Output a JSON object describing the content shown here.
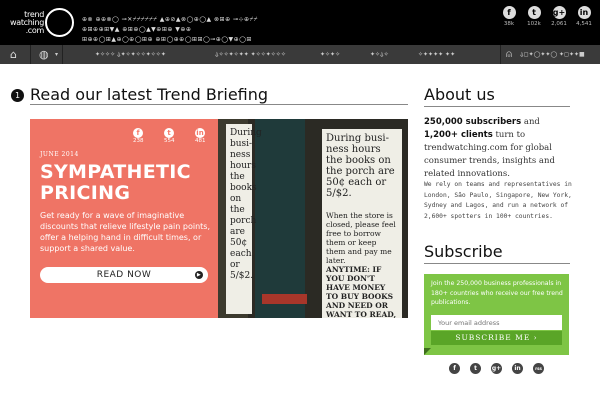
{
  "header": {
    "logo_text": "trend watching .com",
    "tagline": "⊕⊗ ⊕⊕⊗◯ ⊸✕⌿⌿⌿⌿⌿⌿ ▲⊕⊘▲⊗◯⊕◯▲ ⊗⊞⊕ ⊸⊹⊕⌿⌿ ⊕⊞⊕⊕⊞▼▲ ⊕⊞⊕◯▲▼⊕⊞⊕ ▼⊕⊕ ⊞⊕⊕◯⊞▲⊕◯⊕◯⊞⊕ ⊕⊞◯⊕⊕◯⊞⊞◯⊸⊕◯▼⊕◯⊞ ◯◯◯◯◯▼⊕⊞⊕▼⊕⊕▲⊹",
    "socials": [
      {
        "icon": "facebook-icon",
        "glyph": "f",
        "count": "38k"
      },
      {
        "icon": "twitter-icon",
        "glyph": "t",
        "count": "102k"
      },
      {
        "icon": "googleplus-icon",
        "glyph": "g+",
        "count": "2,061"
      },
      {
        "icon": "linkedin-icon",
        "glyph": "in",
        "count": "4,541"
      }
    ]
  },
  "nav": {
    "home_glyph": "⌂",
    "globe_glyph": "◍",
    "caret": "▾",
    "items": [
      "✦✧✧✧ ⍙✦✧✦✧✧✦✧✧✦",
      "⍙✧✧✦✧✦✦ ✦✧✧✦✧✧✧",
      "✦✧✦✧",
      "✦✧⍙✧",
      "✧✦✦✦✦ ✦✦"
    ],
    "account_glyph": "⍝",
    "account": "⍙◻✦◯✦✦◯ ✦◻✦✦■"
  },
  "main": {
    "section_number": "1",
    "heading": "Read our latest Trend Briefing",
    "hero": {
      "date": "JUNE 2014",
      "title": "SYMPATHETIC PRICING",
      "description": "Get ready for a wave of imaginative discounts that relieve lifestyle pain points, offer a helping hand in difficult times, or support a shared value.",
      "button": "READ NOW",
      "shares": [
        {
          "glyph": "f",
          "count": "238"
        },
        {
          "glyph": "t",
          "count": "554"
        },
        {
          "glyph": "in",
          "count": "481"
        }
      ],
      "sign_texts": [
        "During busi- ness hours the books on the porch are 50¢ each or 5/$2.",
        "When the store is closed, please feel free to borrow them or keep them and pay me later.",
        "ANYTIME: IF YOU DON'T HAVE MONEY TO BUY BOOKS AND NEED OR WANT TO READ,"
      ]
    }
  },
  "about": {
    "heading": "About us",
    "lead_bold1": "250,000 subscribers",
    "lead_mid": " and ",
    "lead_bold2": "1,200+ clients",
    "lead_rest": " turn to trendwatching.com for global consumer trends, insights and related innovations.",
    "body": "We rely on teams and representatives in London, São Paulo, Singapore, New York, Sydney and Lagos, and run a network of 2,600+ spotters in 100+ countries."
  },
  "subscribe": {
    "heading": "Subscribe",
    "text": "Join the 250,000 business professionals in 180+ countries who receive our free trend publications.",
    "placeholder": "Your email address",
    "button": "SUBSCRIBE ME ›",
    "footer_socials": [
      "f",
      "t",
      "g+",
      "in",
      "rss"
    ]
  }
}
